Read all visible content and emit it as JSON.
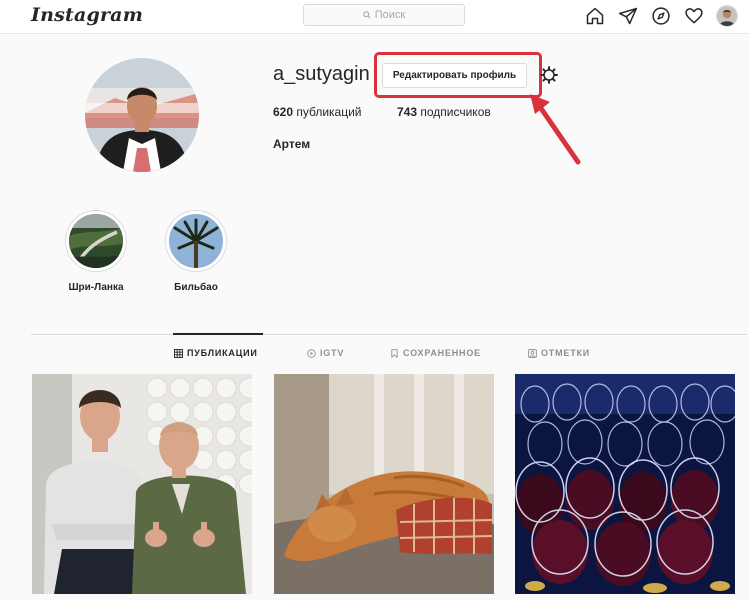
{
  "topbar": {
    "logo": "Instagram",
    "search_placeholder": "Поиск",
    "icons": [
      "home-icon",
      "direct-icon",
      "explore-icon",
      "activity-heart-icon",
      "profile-avatar-icon"
    ]
  },
  "profile": {
    "username": "a_sutyagin",
    "edit_button_label": "Редактировать профиль",
    "posts_count": "620",
    "posts_label": "публикаций",
    "followers_count": "743",
    "followers_label": "подписчиков",
    "full_name": "Артем"
  },
  "highlights": [
    {
      "label": "Шри-Ланка"
    },
    {
      "label": "Бильбао"
    }
  ],
  "tabs": [
    {
      "label": "ПУБЛИКАЦИИ",
      "icon": "grid-icon",
      "active": true
    },
    {
      "label": "IGTV",
      "icon": "igtv-icon",
      "active": false
    },
    {
      "label": "СОХРАНЕННОЕ",
      "icon": "bookmark-icon",
      "active": false
    },
    {
      "label": "ОТМЕТКИ",
      "icon": "tagged-icon",
      "active": false
    }
  ],
  "colors": {
    "annotation_red": "#d9323c",
    "border": "#dbdbdb",
    "text": "#262626",
    "muted": "#8e8e8e"
  }
}
